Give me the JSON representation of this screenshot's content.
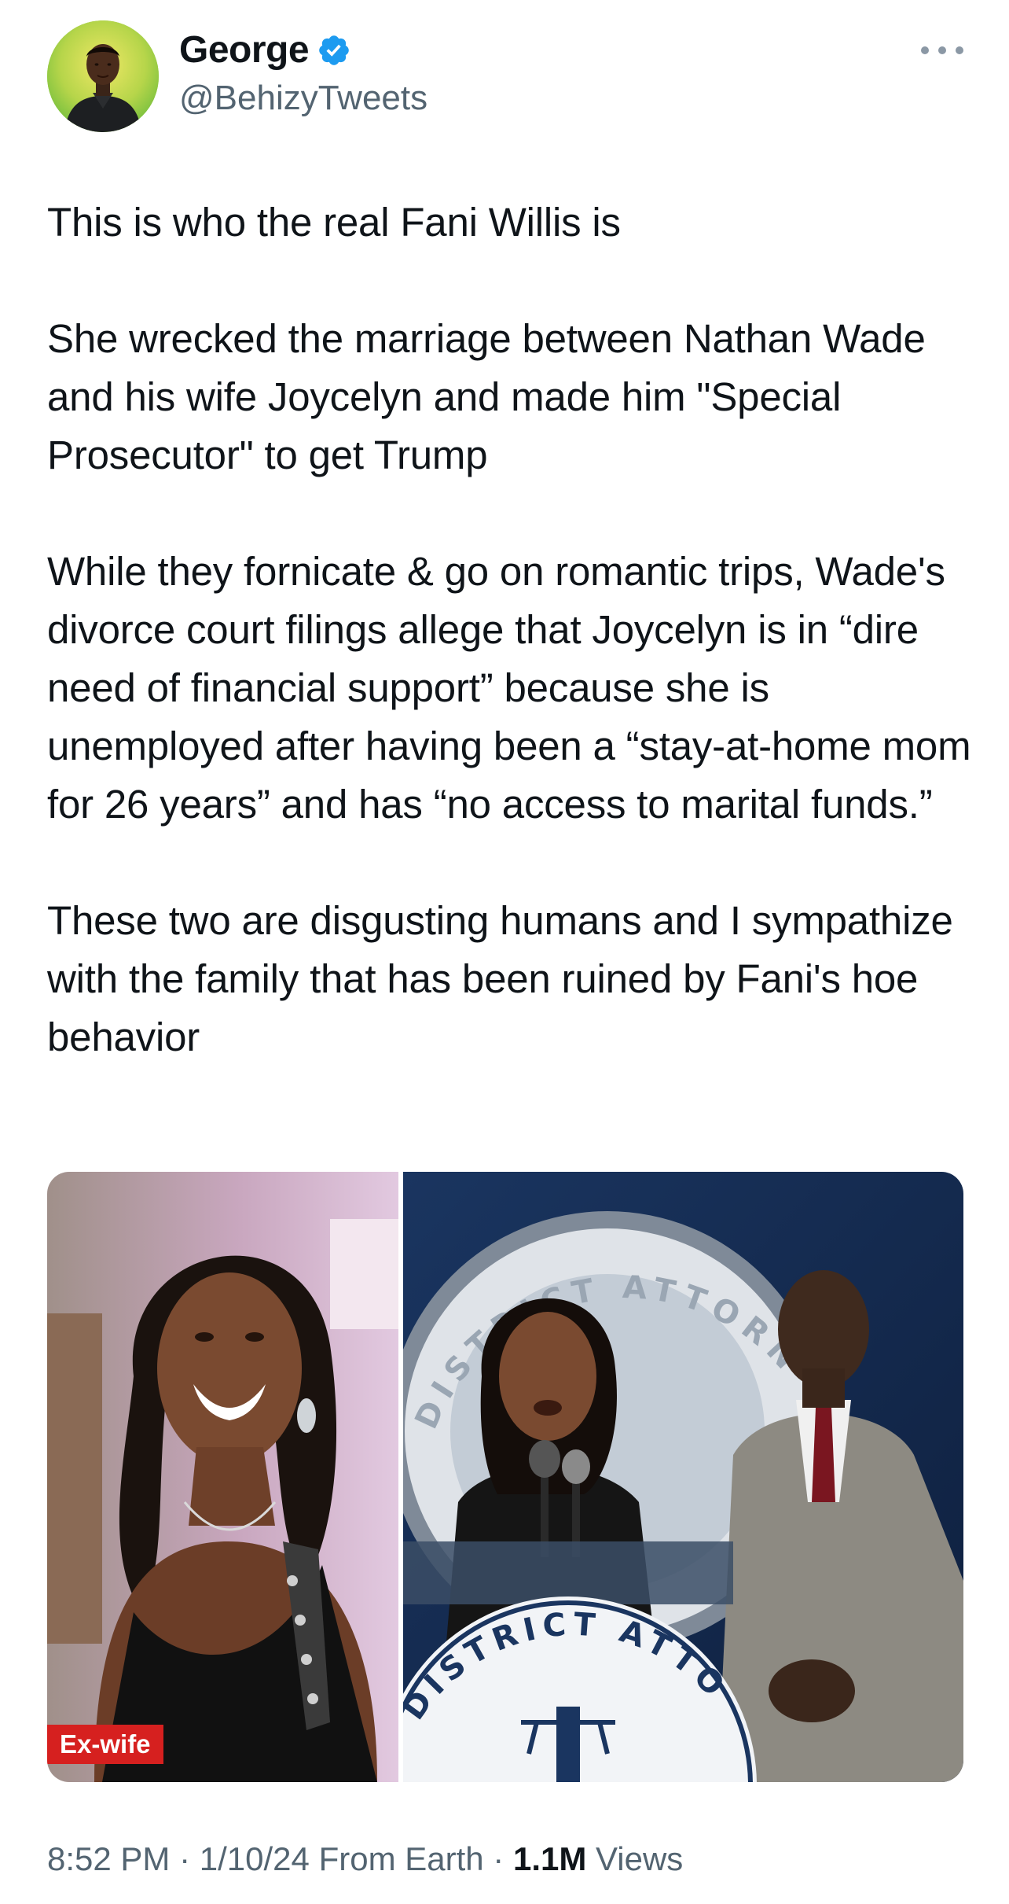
{
  "author": {
    "display_name": "George",
    "handle": "@BehizyTweets",
    "verified": true
  },
  "tweet": {
    "paragraphs": [
      "This is who the real Fani Willis is",
      "She wrecked the marriage between Nathan Wade and his wife Joycelyn and made him \"Special Prosecutor\" to get Trump",
      "While they fornicate & go on romantic trips, Wade's divorce court filings allege that Joycelyn is in “dire need of financial support” because she is unemployed after having been a “stay-at-home mom for 26 years” and has “no access to marital funds.”",
      "These two are disgusting humans and I sympathize with the family that has been ruined by Fani's hoe behavior"
    ],
    "media": {
      "left_badge": "Ex-wife",
      "podium_text": "DISTRICT ATTORNEY",
      "seal_text": "DISTRICT ATTORNEY"
    },
    "meta": {
      "time": "8:52 PM",
      "date": "1/10/24",
      "source": "From Earth",
      "views_count": "1.1M",
      "views_label": "Views",
      "separator": "·"
    }
  },
  "colors": {
    "verified": "#1d9bf0",
    "secondary_text": "#536471",
    "badge": "#d6201f"
  },
  "icons": {
    "verified": "verified-badge-icon",
    "more": "more-options-icon"
  }
}
